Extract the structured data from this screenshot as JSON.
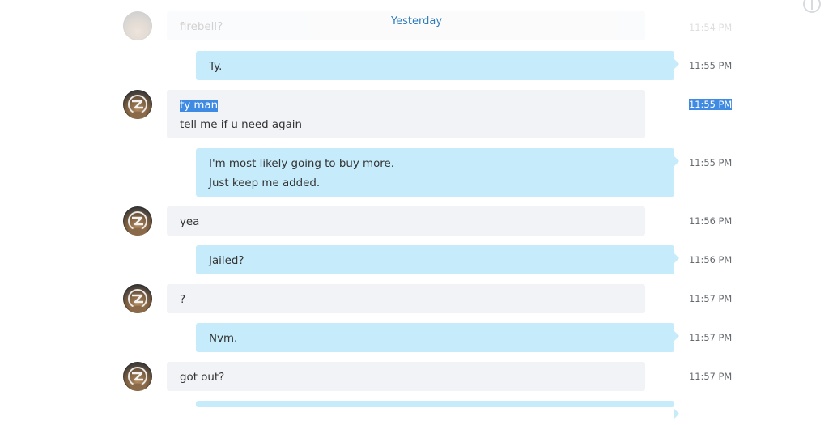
{
  "date_divider": "Yesterday",
  "partial_top": {
    "text": "firebell?",
    "time": "11:54 PM"
  },
  "messages": [
    {
      "direction": "out",
      "lines": [
        "Ty."
      ],
      "time": "11:55 PM"
    },
    {
      "direction": "in",
      "lines": [
        "ty man",
        "tell me if u need again"
      ],
      "time": "11:55 PM",
      "selected": true
    },
    {
      "direction": "out",
      "lines": [
        "I'm most likely going to buy more.",
        "Just keep me added."
      ],
      "time": "11:55 PM"
    },
    {
      "direction": "in",
      "lines": [
        "yea"
      ],
      "time": "11:56 PM"
    },
    {
      "direction": "out",
      "lines": [
        "Jailed?"
      ],
      "time": "11:56 PM"
    },
    {
      "direction": "in",
      "lines": [
        "?"
      ],
      "time": "11:57 PM"
    },
    {
      "direction": "out",
      "lines": [
        "Nvm."
      ],
      "time": "11:57 PM"
    },
    {
      "direction": "in",
      "lines": [
        "got out?"
      ],
      "time": "11:57 PM"
    }
  ],
  "colors": {
    "incoming_bubble": "#f2f3f7",
    "outgoing_bubble": "#c6ebfa",
    "selection": "#3f8ae3",
    "date_divider": "#2f7cbb"
  }
}
